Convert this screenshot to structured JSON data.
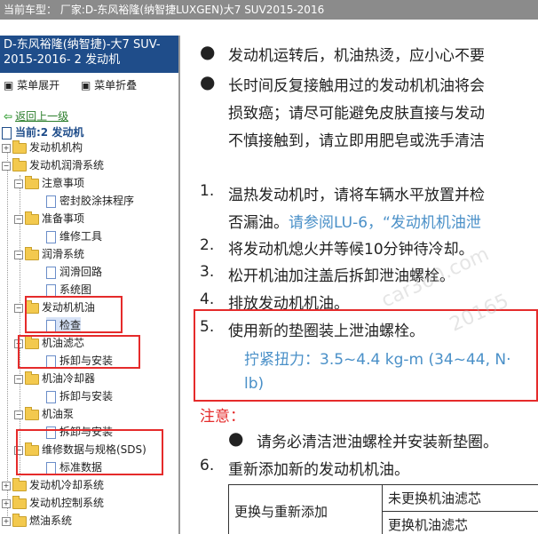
{
  "topbar": {
    "text": "当前车型：  厂家:D-东风裕隆(纳智捷LUXGEN)大7 SUV2015-2016"
  },
  "sidebar": {
    "header": "D-东风裕隆(纳智捷)-大7 SUV-2015-2016- 2 发动机",
    "expand_label": "菜单展开",
    "collapse_label": "菜单折叠",
    "back_label": "返回上一级",
    "current_label": "当前:2 发动机",
    "tree": [
      {
        "label": "发动机机构"
      },
      {
        "label": "发动机润滑系统"
      },
      {
        "label": "注意事项"
      },
      {
        "label": "密封胶涂抹程序"
      },
      {
        "label": "准备事项"
      },
      {
        "label": "维修工具"
      },
      {
        "label": "润滑系统"
      },
      {
        "label": "润滑回路"
      },
      {
        "label": "系统图"
      },
      {
        "label": "发动机机油"
      },
      {
        "label": "检查"
      },
      {
        "label": "机油滤芯"
      },
      {
        "label": "拆卸与安装"
      },
      {
        "label": "机油冷却器"
      },
      {
        "label": "拆卸与安装"
      },
      {
        "label": "机油泵"
      },
      {
        "label": "拆卸与安装"
      },
      {
        "label": "维修数据与规格(SDS)"
      },
      {
        "label": "标准数据"
      },
      {
        "label": "发动机冷却系统"
      },
      {
        "label": "发动机控制系统"
      },
      {
        "label": "燃油系统"
      }
    ]
  },
  "content": {
    "bullet1": "发动机运转后，机油热烫，应小心不要",
    "bullet2_line1": "长时间反复接触用过的发动机机油将会",
    "bullet2_line2": "损致癌；请尽可能避免皮肤直接与发动",
    "bullet2_line3": "不慎接触到，请立即用肥皂或洗手清洁",
    "step1_num": "1.",
    "step1_line1": "温热发动机时，请将车辆水平放置并检",
    "step1_line2_a": "否漏油。",
    "step1_line2_b": "请参阅LU-6，“发动机机油泄",
    "step2_num": "2.",
    "step2": "将发动机熄火并等候10分钟待冷却。",
    "step3_num": "3.",
    "step3": "松开机油加注盖后拆卸泄油螺栓。",
    "step4_num": "4.",
    "step4": "排放发动机机油。",
    "step5_num": "5.",
    "step5": "使用新的垫圈装上泄油螺栓。",
    "torque_line1": "拧紧扭力：3.5~4.4 kg-m (34~44, N·",
    "torque_line2": "lb)",
    "note_label": "注意：",
    "note_text": "请务必清洁泄油螺栓并安装新垫圈。",
    "step6_num": "6.",
    "step6": "重新添加新的发动机机油。",
    "table": {
      "row_header": "更换与重新添加",
      "opt1": "未更换机油滤芯",
      "opt2": "更换机油滤芯"
    }
  },
  "watermark": {
    "text1": "car360.com",
    "text2": "20165"
  }
}
